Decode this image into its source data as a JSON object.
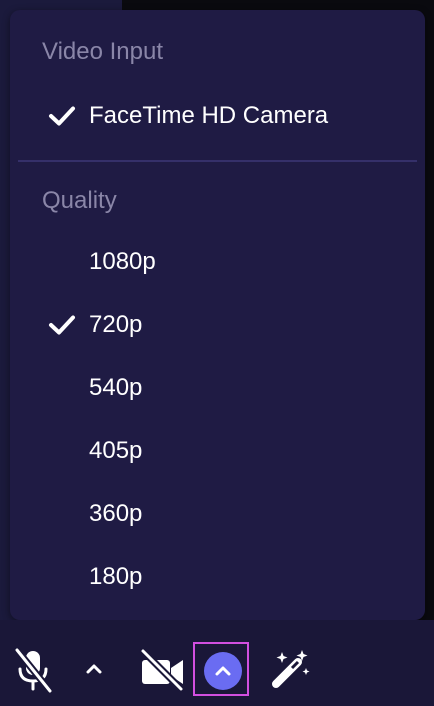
{
  "menu": {
    "video_input": {
      "header": "Video Input",
      "items": [
        {
          "label": "FaceTime HD Camera",
          "selected": true
        }
      ]
    },
    "quality": {
      "header": "Quality",
      "items": [
        {
          "label": "1080p",
          "selected": false
        },
        {
          "label": "720p",
          "selected": true
        },
        {
          "label": "540p",
          "selected": false
        },
        {
          "label": "405p",
          "selected": false
        },
        {
          "label": "360p",
          "selected": false
        },
        {
          "label": "180p",
          "selected": false
        }
      ]
    }
  },
  "toolbar": {
    "buttons": [
      {
        "icon": "microphone-muted-icon"
      },
      {
        "icon": "chevron-up-icon"
      },
      {
        "icon": "camera-off-icon"
      },
      {
        "icon": "chevron-up-icon",
        "active": true
      },
      {
        "icon": "magic-wand-icon"
      }
    ]
  },
  "colors": {
    "menu_bg": "#1f1b44",
    "header_text": "#8a86a8",
    "item_text": "#ffffff",
    "accent": "#6a6cf2",
    "focus_ring": "#d24fe0",
    "toolbar_bg": "#1a1738"
  }
}
